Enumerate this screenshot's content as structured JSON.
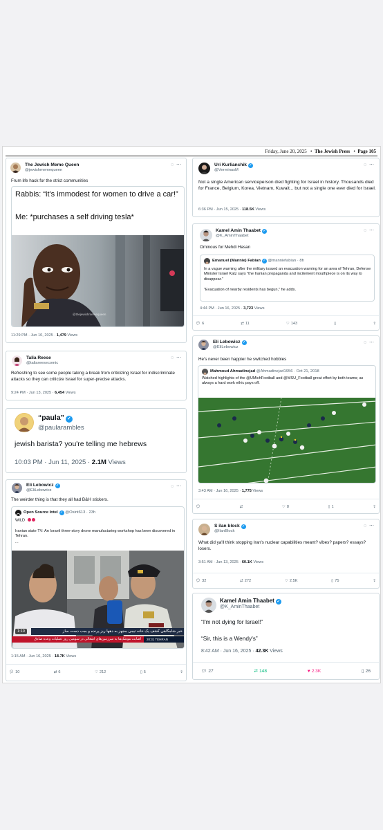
{
  "masthead": {
    "date": "Friday, June 20, 2025",
    "paper": "The Jewish Press",
    "page": "Page 105"
  },
  "tweets": {
    "t1": {
      "name": "The Jewish Meme Queen",
      "handle": "@jewishmemequeen",
      "text": "Frum life hack for the strict communities",
      "meme_line1": "Rabbis: “it's immodest for women to drive a car!”",
      "meme_line2": "Me: *purchases a self driving tesla*",
      "watermark": "@thejewishmemequeen",
      "time": "11:29 PM · Jun 10, 2025 · ",
      "views": "1,479",
      "views_label": "Views"
    },
    "t2": {
      "name": "Talia Reese",
      "handle": "@taliareesecomic",
      "text": "Refreshing to see some people taking a break from criticizing Israel for indiscriminate attacks so they can criticize Israel for super-precise attacks.",
      "time": "9:24 PM · Jun 13, 2025 · ",
      "views": "6,454",
      "views_label": "Views"
    },
    "t3": {
      "name": "“paula”",
      "handle": "@paularambles",
      "text": "jewish barista? you're telling me hebrews",
      "time": "10:03 PM · Jun 11, 2025 · ",
      "views": "2.1M",
      "views_label": "Views"
    },
    "t4": {
      "name": "Eli Lebowicz",
      "handle": "@EliLebowicz",
      "text": "The weirder thing is that they all had B&H stickers.",
      "q_name": "Open Source Intel",
      "q_handle": "@Osint613 · 23h",
      "q_wild": "WILD",
      "q_text": "Iranian state TV: An Israeli three-story drone manufacturing workshop has been discovered in Tehran.",
      "q_ellipsis": "...",
      "video_time": "1:10",
      "ticker1": "خبر شامگاهی   کشف یک خانه تیمی مجهز به دهها ریز پرنده و بمب دست ساز",
      "ticker2": "اصابت موشک‌ها به سرزمین‌های اشغالی در سومین روز عملیات وعده صادق",
      "ticker_clock": "20:31  TEHRAN",
      "time": "1:15 AM · Jun 16, 2025 · ",
      "views": "18.7K",
      "views_label": "Views",
      "replies": "10",
      "reposts": "6",
      "likes": "212",
      "bookmarks": "5"
    },
    "t5": {
      "name": "Uri Kurlianchik",
      "handle": "@VerminusM",
      "text": "Not a single American serviceperson died fighting for Israel in history. Thousands died for France, Belgium, Korea, Vietnam, Kuwait... but not a single one ever died for Israel.",
      "time": "6:36 PM · Jun 15, 2025 · ",
      "views": "118.5K",
      "views_label": "Views"
    },
    "t6": {
      "name": "Kamel Amin Thaabet",
      "handle": "@K_AminThaabet",
      "text": "Ominous for Mehdi Hasan",
      "q_name": "Emanuel (Mannie) Fabian",
      "q_handle": "@manniefabian · 8h",
      "q_text": "In a vague warning after the military issued an evacuation warning for an area of Tehran, Defense Minister Israel Katz says \"the Iranian propaganda and incitement mouthpiece is on its way to disappear.\"",
      "q_text2": "\"Evacuation of nearby residents has begun,\" he adds.",
      "time": "4:44 PM · Jun 16, 2025 · ",
      "views": "3,723",
      "views_label": "Views",
      "replies": "6",
      "reposts": "11",
      "likes": "143"
    },
    "t7": {
      "name": "Eli Lebowicz",
      "handle": "@EliLebowicz",
      "text": "He's never been happier he switched hobbies",
      "q_name": "Mahmoud Ahmadinejad",
      "q_handle": "@Ahmadinejad1956 · Oct 21, 2018",
      "q_text": "Watched highlights of the @UMichFootball  and @MSU_Football  great effort by both teams; as always a hard work ethic pays off.",
      "time": "3:43 AM · Jun 16, 2025 · ",
      "views": "1,775",
      "views_label": "Views",
      "likes": "8",
      "bookmarks": "1"
    },
    "t8": {
      "name": "S ilan block",
      "handle": "@IlanBlock",
      "text": "What did ya'll think stopping Iran's nuclear capabilities meant? vibes? papers? essays? losers.",
      "time": "3:51 AM · Jun 13, 2025 · ",
      "views": "60.1K",
      "views_label": "Views",
      "replies": "32",
      "reposts": "272",
      "likes": "2.5K",
      "bookmarks": "75"
    },
    "t9": {
      "name": "Kamel Amin Thaabet",
      "handle": "@K_AminThaabet",
      "line1": "“I'm not dying for Israel!”",
      "line2": "“Sir, this is a Wendy's”",
      "time": "8:42 AM · Jun 16, 2025 · ",
      "views": "42.3K",
      "views_label": "Views",
      "replies": "27",
      "reposts": "148",
      "likes": "2.3K",
      "bookmarks": "26"
    }
  },
  "colors": {
    "blue": "#1d9bf0",
    "green": "#00ba7c",
    "pink": "#f91880",
    "gray": "#536471"
  }
}
